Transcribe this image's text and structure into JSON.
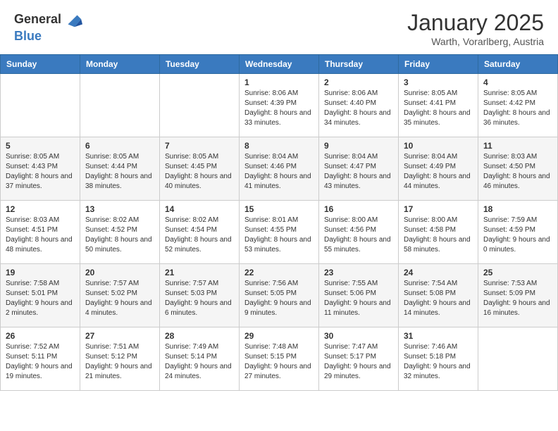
{
  "header": {
    "logo_general": "General",
    "logo_blue": "Blue",
    "title": "January 2025",
    "subtitle": "Warth, Vorarlberg, Austria"
  },
  "days_of_week": [
    "Sunday",
    "Monday",
    "Tuesday",
    "Wednesday",
    "Thursday",
    "Friday",
    "Saturday"
  ],
  "weeks": [
    [
      {
        "day": null,
        "info": null
      },
      {
        "day": null,
        "info": null
      },
      {
        "day": null,
        "info": null
      },
      {
        "day": "1",
        "sunrise": "8:06 AM",
        "sunset": "4:39 PM",
        "daylight": "8 hours and 33 minutes."
      },
      {
        "day": "2",
        "sunrise": "8:06 AM",
        "sunset": "4:40 PM",
        "daylight": "8 hours and 34 minutes."
      },
      {
        "day": "3",
        "sunrise": "8:05 AM",
        "sunset": "4:41 PM",
        "daylight": "8 hours and 35 minutes."
      },
      {
        "day": "4",
        "sunrise": "8:05 AM",
        "sunset": "4:42 PM",
        "daylight": "8 hours and 36 minutes."
      }
    ],
    [
      {
        "day": "5",
        "sunrise": "8:05 AM",
        "sunset": "4:43 PM",
        "daylight": "8 hours and 37 minutes."
      },
      {
        "day": "6",
        "sunrise": "8:05 AM",
        "sunset": "4:44 PM",
        "daylight": "8 hours and 38 minutes."
      },
      {
        "day": "7",
        "sunrise": "8:05 AM",
        "sunset": "4:45 PM",
        "daylight": "8 hours and 40 minutes."
      },
      {
        "day": "8",
        "sunrise": "8:04 AM",
        "sunset": "4:46 PM",
        "daylight": "8 hours and 41 minutes."
      },
      {
        "day": "9",
        "sunrise": "8:04 AM",
        "sunset": "4:47 PM",
        "daylight": "8 hours and 43 minutes."
      },
      {
        "day": "10",
        "sunrise": "8:04 AM",
        "sunset": "4:49 PM",
        "daylight": "8 hours and 44 minutes."
      },
      {
        "day": "11",
        "sunrise": "8:03 AM",
        "sunset": "4:50 PM",
        "daylight": "8 hours and 46 minutes."
      }
    ],
    [
      {
        "day": "12",
        "sunrise": "8:03 AM",
        "sunset": "4:51 PM",
        "daylight": "8 hours and 48 minutes."
      },
      {
        "day": "13",
        "sunrise": "8:02 AM",
        "sunset": "4:52 PM",
        "daylight": "8 hours and 50 minutes."
      },
      {
        "day": "14",
        "sunrise": "8:02 AM",
        "sunset": "4:54 PM",
        "daylight": "8 hours and 52 minutes."
      },
      {
        "day": "15",
        "sunrise": "8:01 AM",
        "sunset": "4:55 PM",
        "daylight": "8 hours and 53 minutes."
      },
      {
        "day": "16",
        "sunrise": "8:00 AM",
        "sunset": "4:56 PM",
        "daylight": "8 hours and 55 minutes."
      },
      {
        "day": "17",
        "sunrise": "8:00 AM",
        "sunset": "4:58 PM",
        "daylight": "8 hours and 58 minutes."
      },
      {
        "day": "18",
        "sunrise": "7:59 AM",
        "sunset": "4:59 PM",
        "daylight": "9 hours and 0 minutes."
      }
    ],
    [
      {
        "day": "19",
        "sunrise": "7:58 AM",
        "sunset": "5:01 PM",
        "daylight": "9 hours and 2 minutes."
      },
      {
        "day": "20",
        "sunrise": "7:57 AM",
        "sunset": "5:02 PM",
        "daylight": "9 hours and 4 minutes."
      },
      {
        "day": "21",
        "sunrise": "7:57 AM",
        "sunset": "5:03 PM",
        "daylight": "9 hours and 6 minutes."
      },
      {
        "day": "22",
        "sunrise": "7:56 AM",
        "sunset": "5:05 PM",
        "daylight": "9 hours and 9 minutes."
      },
      {
        "day": "23",
        "sunrise": "7:55 AM",
        "sunset": "5:06 PM",
        "daylight": "9 hours and 11 minutes."
      },
      {
        "day": "24",
        "sunrise": "7:54 AM",
        "sunset": "5:08 PM",
        "daylight": "9 hours and 14 minutes."
      },
      {
        "day": "25",
        "sunrise": "7:53 AM",
        "sunset": "5:09 PM",
        "daylight": "9 hours and 16 minutes."
      }
    ],
    [
      {
        "day": "26",
        "sunrise": "7:52 AM",
        "sunset": "5:11 PM",
        "daylight": "9 hours and 19 minutes."
      },
      {
        "day": "27",
        "sunrise": "7:51 AM",
        "sunset": "5:12 PM",
        "daylight": "9 hours and 21 minutes."
      },
      {
        "day": "28",
        "sunrise": "7:49 AM",
        "sunset": "5:14 PM",
        "daylight": "9 hours and 24 minutes."
      },
      {
        "day": "29",
        "sunrise": "7:48 AM",
        "sunset": "5:15 PM",
        "daylight": "9 hours and 27 minutes."
      },
      {
        "day": "30",
        "sunrise": "7:47 AM",
        "sunset": "5:17 PM",
        "daylight": "9 hours and 29 minutes."
      },
      {
        "day": "31",
        "sunrise": "7:46 AM",
        "sunset": "5:18 PM",
        "daylight": "9 hours and 32 minutes."
      },
      {
        "day": null,
        "info": null
      }
    ]
  ]
}
